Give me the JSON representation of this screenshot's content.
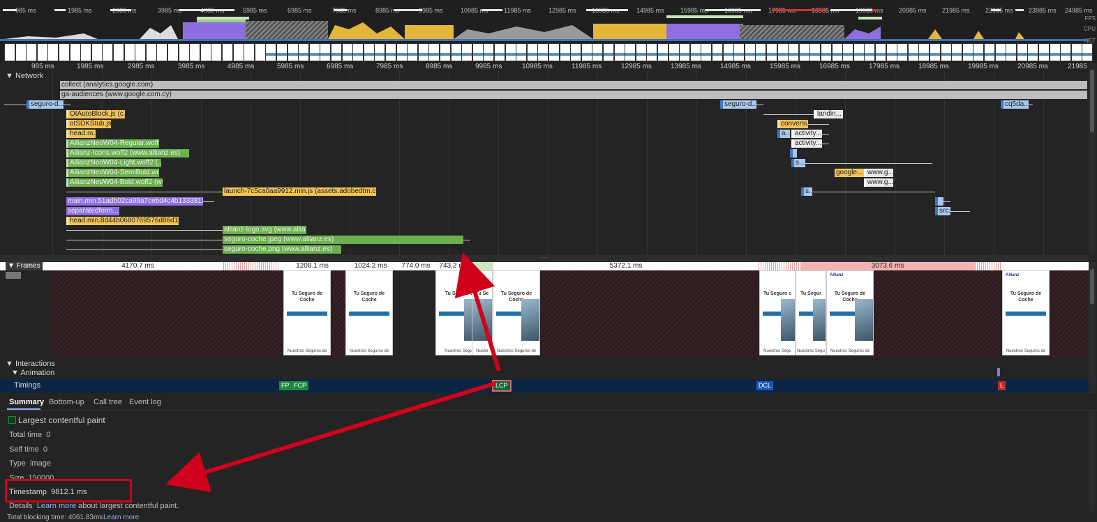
{
  "overview": {
    "ticks": [
      "985 ms",
      "1985 ms",
      "2985 ms",
      "3985 ms",
      "4985 ms",
      "5985 ms",
      "6985 ms",
      "7985 ms",
      "8985 ms",
      "9985 ms",
      "10985 ms",
      "11985 ms",
      "12985 ms",
      "13985 ms",
      "14985 ms",
      "15985 ms",
      "16985 ms",
      "17985 ms",
      "18985 ms",
      "19985 ms",
      "20985 ms",
      "21985 ms",
      "22985 ms",
      "23985 ms",
      "24985 ms"
    ],
    "labels": {
      "fps": "FPS",
      "cpu": "CPU",
      "net": "NET"
    }
  },
  "ruler": {
    "ticks": [
      "985 ms",
      "1985 ms",
      "2985 ms",
      "3985 ms",
      "4985 ms",
      "5985 ms",
      "6985 ms",
      "7985 ms",
      "8985 ms",
      "9985 ms",
      "10985 ms",
      "11985 ms",
      "12985 ms",
      "13985 ms",
      "14985 ms",
      "15985 ms",
      "16985 ms",
      "17985 ms",
      "18985 ms",
      "19985 ms",
      "20985 ms",
      "21985"
    ]
  },
  "network": {
    "title": "▼ Network",
    "requests": [
      "collect (analytics.google.com)",
      "ga-audiences (www.google.com.cy)",
      "seguro-d...",
      "OtAutoBlock.js (c...",
      "otSDKStub.js...",
      "head.m...",
      "AllianzNeoW04-Regular.woff2...",
      "Allianz-Icons.woff2 (www.allianz.es)",
      "AllianzNeoW04-Light.woff2 (...",
      "AllianzNeoW04-SemiBold.wof...",
      "AllianzNeoW04-Bold.woff2 (ww...",
      "launch-7c5ca0aa9912.min.js (assets.adobedtm.com)",
      "main.min.51adb02ca99a7cebd4c4b13338110c...",
      "separatedform...",
      "head.min.8d44b0680769576d86d15c...",
      "allianz-logo.svg (www.allia...",
      "seguro-coche.jpeg (www.allianz.es)",
      "seguro-coche.png (www.allianz.es)",
      "seguro-d...",
      "landin...",
      "conversi...",
      "a...",
      "activity...",
      "activity...",
      "s...",
      "google...",
      "www.g...",
      "www.g...",
      "s...",
      "src...",
      "cq5da..."
    ]
  },
  "frames": {
    "title": "▼ Frames",
    "durations": [
      "4170.7 ms",
      "1208.1 ms",
      "1024.2 ms",
      "774.0 ms",
      "743.2 ms",
      "5372.1 ms",
      "3073.6 ms"
    ],
    "shot_title": "Tu Seguro de Coche",
    "shot_bottom_normal": "Nuestros Seguros de",
    "shot_bottom_cut1": "Nuestros Segur",
    "shot_bottom_cut2": "Nuestr",
    "shot_bottom_cut3": "Nuestros Segu",
    "shot_title_cut1": "Tu Seguro d",
    "shot_title_cut2": "Tu Se",
    "shot_title_cut3": "Tu Seguro c",
    "shot_title_cut4": "Tu Segur",
    "shot_title_cut5": "Coche",
    "shot_title_cut6": "Cochi",
    "shot_title_cut7": "C",
    "brand": "Allianz"
  },
  "interactions": {
    "title": "▼ Interactions",
    "animation": "▼ Animation"
  },
  "timings": {
    "title": "Timings",
    "markers": {
      "fp": "FP",
      "fcp": "FCP",
      "lcp": "LCP",
      "dcl": "DCL",
      "l": "L"
    },
    "colors": {
      "fp": "#1a8a3a",
      "fcp": "#1a8a3a",
      "lcp": "#0e6b3b",
      "dcl": "#1a5bb5",
      "l": "#c62828"
    }
  },
  "tabs": [
    "Summary",
    "Bottom-up",
    "Call tree",
    "Event log"
  ],
  "summary": {
    "title": "Largest contentful paint",
    "rows": [
      {
        "label": "Total time",
        "value": "0"
      },
      {
        "label": "Self time",
        "value": "0"
      },
      {
        "label": "Type",
        "value": "image"
      },
      {
        "label": "Size",
        "value": "150000"
      },
      {
        "label": "Timestamp",
        "value": "9812.1 ms"
      }
    ],
    "details_label": "Details",
    "details_link": "Learn more",
    "details_rest": "about largest contentful paint."
  },
  "footer": {
    "text": "Total blocking time: 4061.83ms",
    "link": "Learn more"
  },
  "annotation_color": "#d0021b"
}
